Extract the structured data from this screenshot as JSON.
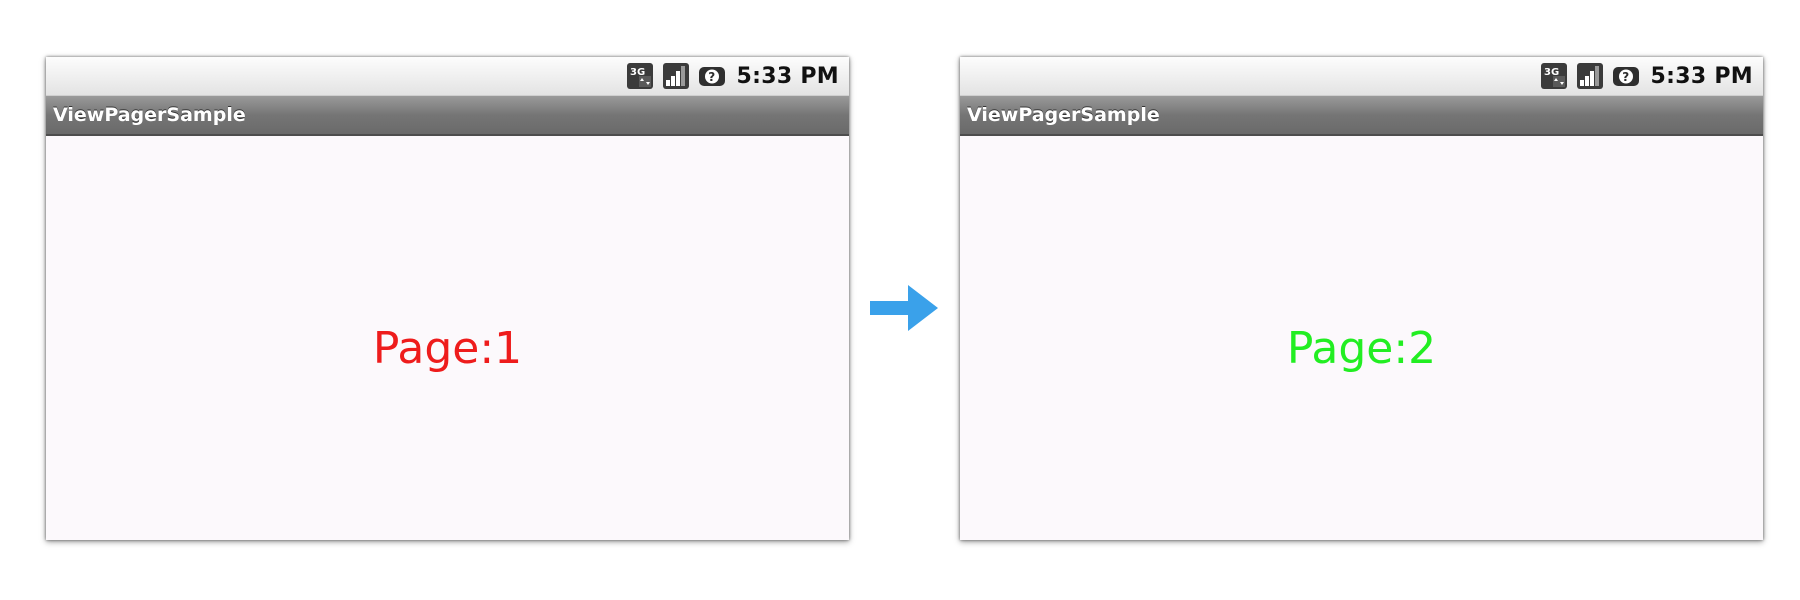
{
  "screens": [
    {
      "status_time": "5:33 PM",
      "app_title": "ViewPagerSample",
      "page_label": "Page:1",
      "page_label_color": "#ee1c1c"
    },
    {
      "status_time": "5:33 PM",
      "app_title": "ViewPagerSample",
      "page_label": "Page:2",
      "page_label_color": "#22ee22"
    }
  ],
  "status_icons": [
    "3g-data-icon",
    "signal-strength-icon",
    "battery-unknown-icon"
  ],
  "transition_arrow_color": "#3aa1ea"
}
